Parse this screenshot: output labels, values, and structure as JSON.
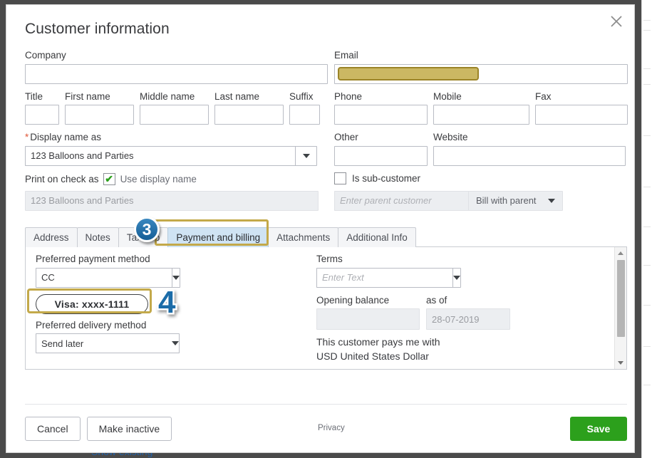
{
  "dialog": {
    "title": "Customer information",
    "close_icon": "close-icon"
  },
  "form": {
    "company": {
      "label": "Company",
      "value": ""
    },
    "title_name": {
      "label": "Title",
      "value": ""
    },
    "first_name": {
      "label": "First name",
      "value": ""
    },
    "middle_name": {
      "label": "Middle name",
      "value": ""
    },
    "last_name": {
      "label": "Last name",
      "value": ""
    },
    "suffix": {
      "label": "Suffix",
      "value": ""
    },
    "display_name": {
      "label": "Display name as",
      "value": "123 Balloons and Parties",
      "required_marker": "*"
    },
    "print_on_check": {
      "label": "Print on check as",
      "checkbox_glyph": "✔",
      "checkbox_label": "Use display name",
      "value": "123 Balloons and Parties"
    },
    "email": {
      "label": "Email",
      "value": "",
      "redacted": true
    },
    "phone": {
      "label": "Phone",
      "value": ""
    },
    "mobile": {
      "label": "Mobile",
      "value": ""
    },
    "fax": {
      "label": "Fax",
      "value": ""
    },
    "other": {
      "label": "Other",
      "value": ""
    },
    "website": {
      "label": "Website",
      "value": ""
    },
    "is_sub_customer": {
      "label": "Is sub-customer",
      "checked": false
    },
    "parent_customer": {
      "placeholder": "Enter parent customer",
      "value": ""
    },
    "bill_with_parent": {
      "label": "Bill with parent"
    }
  },
  "tabs": {
    "items": [
      {
        "label": "Address",
        "active": false
      },
      {
        "label": "Notes",
        "active": false
      },
      {
        "label": "Tax info",
        "active": false
      },
      {
        "label": "Payment and billing",
        "active": true
      },
      {
        "label": "Attachments",
        "active": false
      },
      {
        "label": "Additional Info",
        "active": false
      }
    ]
  },
  "payment_tab": {
    "preferred_payment_method": {
      "label": "Preferred payment method",
      "value": "CC"
    },
    "card": {
      "label": "Visa: xxxx-1111"
    },
    "preferred_delivery_method": {
      "label": "Preferred delivery method",
      "value": "Send later"
    },
    "terms": {
      "label": "Terms",
      "placeholder": "Enter Text",
      "value": ""
    },
    "opening_balance": {
      "label": "Opening balance",
      "value": ""
    },
    "as_of": {
      "label": "as of",
      "value": "28-07-2019"
    },
    "pays_me_with": {
      "label": "This customer pays me with",
      "value": "USD United States Dollar"
    }
  },
  "footer": {
    "cancel": "Cancel",
    "make_inactive": "Make inactive",
    "privacy": "Privacy",
    "save": "Save"
  },
  "background": {
    "clipped_link": "Show existing"
  },
  "annotations": [
    {
      "number": "3",
      "style": "circle",
      "target": "payment-and-billing-tab"
    },
    {
      "number": "4",
      "style": "plain",
      "target": "visa-card-pill"
    }
  ],
  "colors": {
    "highlight_gold": "#c3a94a",
    "redaction_fill": "#cbb863",
    "redaction_border": "#9b8428",
    "active_tab": "#cfe3f3",
    "annotation_blue": "#1b6ca8",
    "save_green": "#2ca01c",
    "required_red": "#e0593b"
  }
}
